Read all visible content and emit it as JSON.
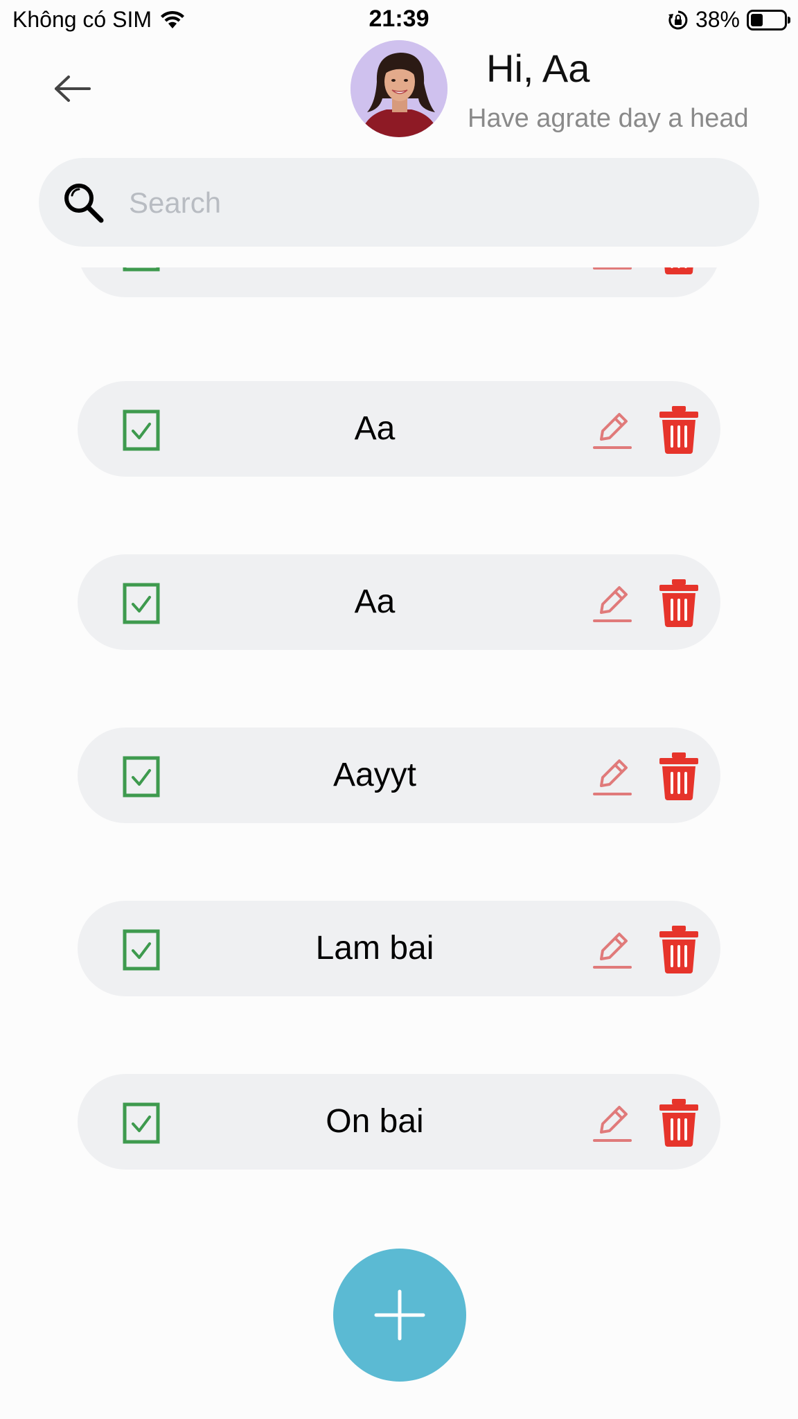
{
  "status_bar": {
    "carrier": "Không có SIM",
    "time": "21:39",
    "battery_percent": "38%",
    "battery_level": 0.38
  },
  "header": {
    "greeting": "Hi, Aa",
    "subtitle": "Have agrate day a head",
    "back_icon": "arrow-left-icon",
    "avatar": "user-avatar"
  },
  "search": {
    "placeholder": "Search",
    "value": "",
    "icon": "search-icon"
  },
  "todos": [
    {
      "label": "",
      "checked": true
    },
    {
      "label": "Aa",
      "checked": true
    },
    {
      "label": "Aa",
      "checked": true
    },
    {
      "label": "Aayyt",
      "checked": true
    },
    {
      "label": "Lam bai",
      "checked": true
    },
    {
      "label": "On bai",
      "checked": true
    }
  ],
  "fab": {
    "icon": "plus-icon"
  },
  "colors": {
    "check_green": "#3e9a4e",
    "edit_red": "#e07a7a",
    "delete_red": "#e6342b",
    "fab_blue": "#5bbad3",
    "item_bg": "#eff0f2"
  }
}
